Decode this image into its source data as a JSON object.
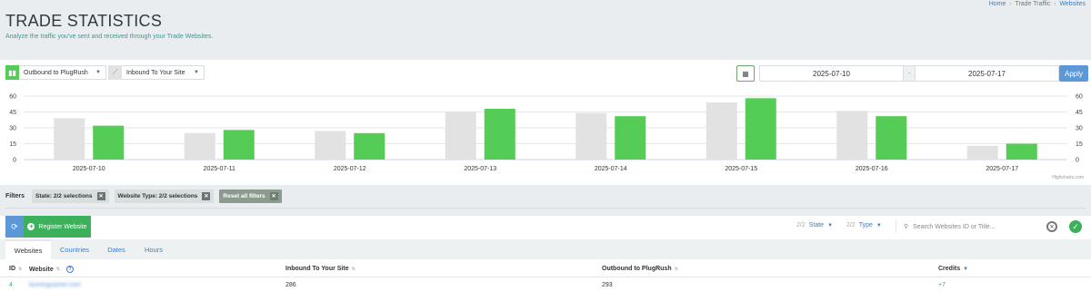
{
  "header": {
    "title": "TRADE STATISTICS",
    "subtitle": "Analyze the traffic you've sent and received through your Trade Websites.",
    "breadcrumb": [
      "Home",
      "Trade Traffic",
      "Websites"
    ]
  },
  "controls": {
    "series1": {
      "label": "Outbound to PlugRush",
      "color": "#55cc55"
    },
    "series2": {
      "label": "Inbound To Your Site",
      "color": "#e2e2e2"
    },
    "date_from": "2025-07-10",
    "date_sep": "-",
    "date_to": "2025-07-17",
    "apply_label": "Apply"
  },
  "chart_data": {
    "type": "bar",
    "categories": [
      "2025-07-10",
      "2025-07-11",
      "2025-07-12",
      "2025-07-13",
      "2025-07-14",
      "2025-07-15",
      "2025-07-16",
      "2025-07-17"
    ],
    "series": [
      {
        "name": "Inbound To Your Site",
        "color": "#e2e2e2",
        "values": [
          39,
          25,
          27,
          45,
          44,
          54,
          46,
          13
        ]
      },
      {
        "name": "Outbound to PlugRush",
        "color": "#55cc55",
        "values": [
          32,
          28,
          25,
          48,
          41,
          58,
          41,
          15
        ]
      }
    ],
    "yticks": [
      0,
      15,
      30,
      45,
      60
    ],
    "ylim": [
      0,
      60
    ],
    "grid": true,
    "credits": "Highcharts.com"
  },
  "filters": {
    "label": "Filters",
    "chips": [
      "State: 2/2 selections",
      "Website Type: 2/2 selections"
    ],
    "reset": "Reset all filters"
  },
  "toolbar": {
    "register": "Register Website",
    "state": {
      "count": "2/2",
      "label": "State"
    },
    "type": {
      "count": "2/2",
      "label": "Type"
    },
    "search_placeholder": "Search Websites ID or Title..."
  },
  "tabs": [
    "Websites",
    "Countries",
    "Dates",
    "Hours"
  ],
  "table": {
    "headers": {
      "id": "ID",
      "website": "Website",
      "inbound": "Inbound To Your Site",
      "outbound": "Outbound to PlugRush",
      "credits": "Credits"
    },
    "rows": [
      {
        "id": "4",
        "website": "bumingcamel.com",
        "inbound": "286",
        "outbound": "293",
        "credits": "+7"
      }
    ]
  }
}
